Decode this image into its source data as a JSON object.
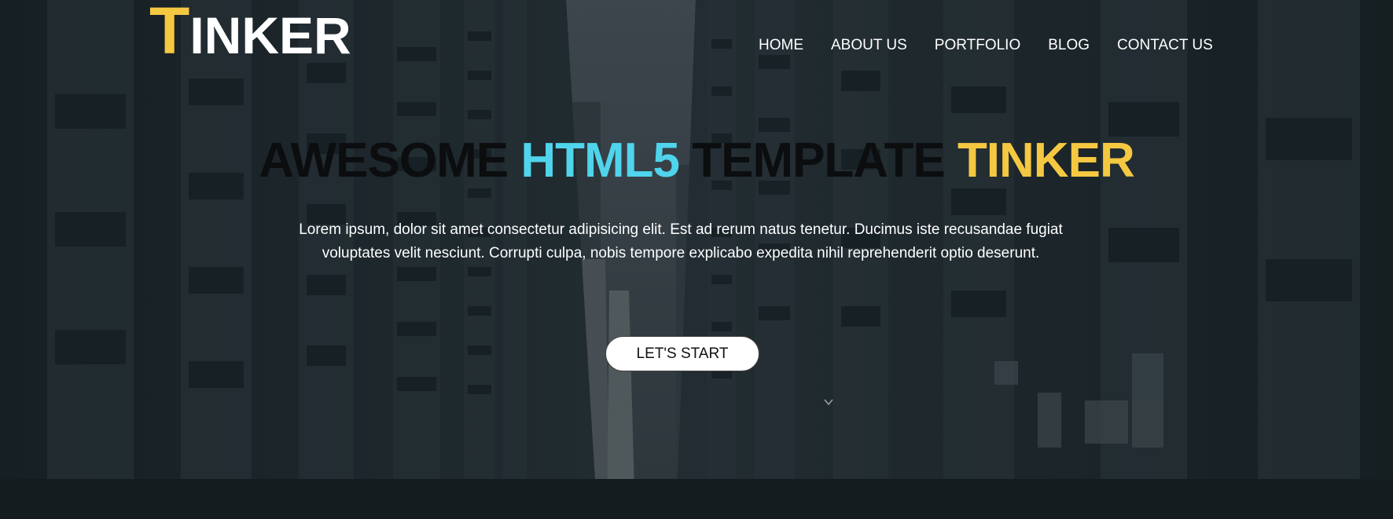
{
  "header": {
    "logo_first_letter": "T",
    "logo_rest": "INKER",
    "nav": [
      {
        "label": "HOME"
      },
      {
        "label": "ABOUT US"
      },
      {
        "label": "PORTFOLIO"
      },
      {
        "label": "BLOG"
      },
      {
        "label": "CONTACT US"
      }
    ]
  },
  "hero": {
    "headline": {
      "word1": "AWESOME",
      "word2": "HTML5",
      "word3": "TEMPLATE",
      "word4": "TINKER"
    },
    "subtext": "Lorem ipsum, dolor sit amet consectetur adipisicing elit. Est ad rerum natus tenetur. Ducimus iste recusandae fugiat voluptates velit nesciunt. Corrupti culpa, nobis tempore explicabo expedita nihil reprehenderit optio deserunt.",
    "cta_label": "LET'S START"
  },
  "colors": {
    "accent_yellow": "#f5c842",
    "accent_cyan": "#4fd4ec",
    "background": "#1f2b31"
  },
  "icons": {
    "scroll_hint": "chevron-down-icon"
  }
}
